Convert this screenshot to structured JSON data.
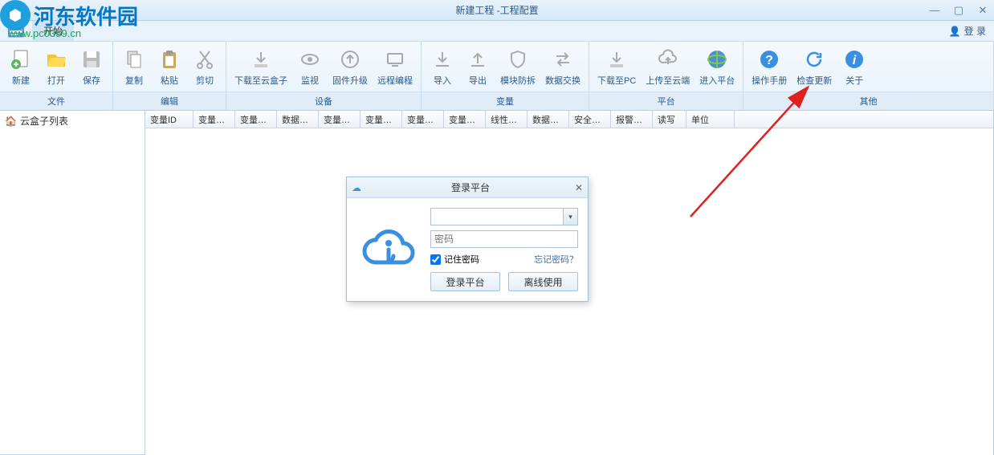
{
  "watermark": {
    "name": "河东软件园",
    "url": "www.pc0359.cn"
  },
  "title": "新建工程 -工程配置",
  "menubar": {
    "start": "开始",
    "login": "登 录"
  },
  "ribbon": {
    "groups": [
      {
        "label": "文件",
        "buttons": [
          "新建",
          "打开",
          "保存"
        ]
      },
      {
        "label": "编辑",
        "buttons": [
          "复制",
          "粘贴",
          "剪切"
        ]
      },
      {
        "label": "设备",
        "buttons": [
          "下载至云盒子",
          "监视",
          "固件升级",
          "远程编程"
        ]
      },
      {
        "label": "变量",
        "buttons": [
          "导入",
          "导出",
          "模块防拆",
          "数据交换"
        ]
      },
      {
        "label": "平台",
        "buttons": [
          "下载至PC",
          "上传至云端",
          "进入平台"
        ]
      },
      {
        "label": "其他",
        "buttons": [
          "操作手册",
          "检查更新",
          "关于"
        ]
      }
    ]
  },
  "sidebar": {
    "root": "云盒子列表"
  },
  "table": {
    "columns": [
      "变量ID",
      "变量…",
      "变量…",
      "数据…",
      "变量…",
      "变量…",
      "变量…",
      "变量…",
      "线性…",
      "数据…",
      "安全…",
      "报警…",
      "读写",
      "单位"
    ]
  },
  "dialog": {
    "title": "登录平台",
    "password_placeholder": "密码",
    "remember": "记住密码",
    "forgot": "忘记密码？",
    "login_btn": "登录平台",
    "offline_btn": "离线使用"
  }
}
